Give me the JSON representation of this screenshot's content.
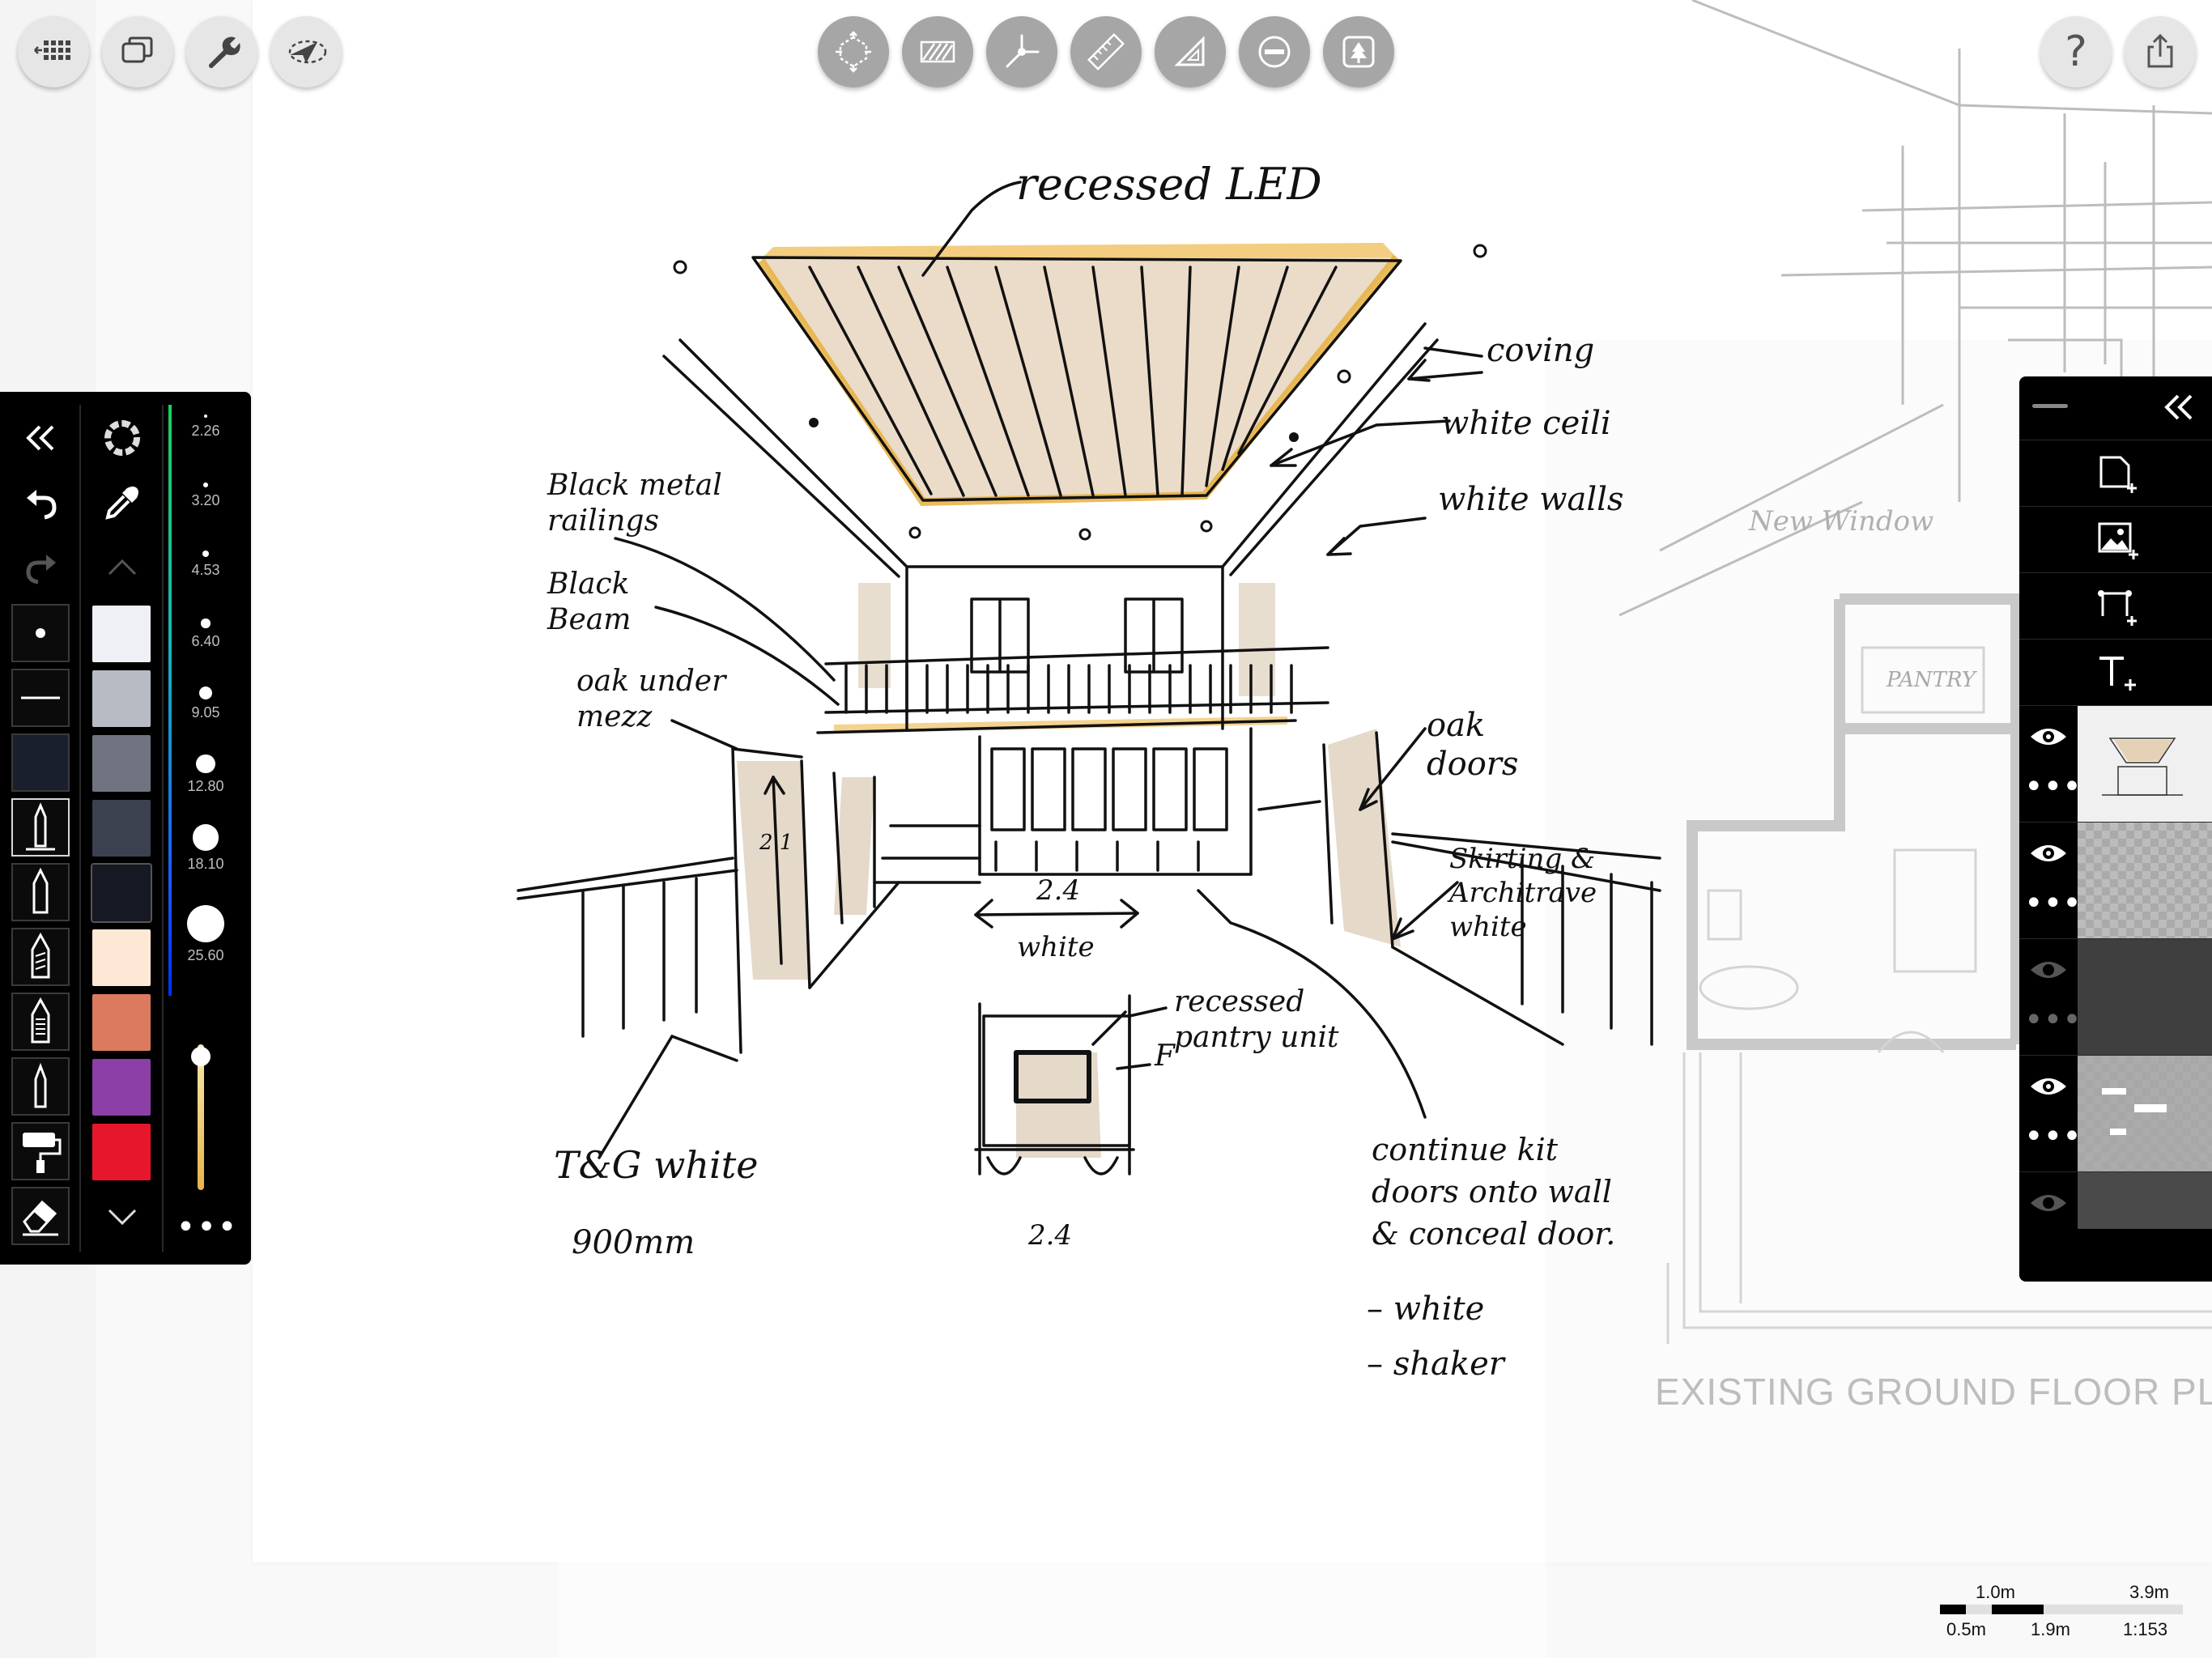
{
  "toolbar_left": {
    "gallery_icon": "grid-back-icon",
    "layers_toggle_icon": "duplicate-icon",
    "settings_icon": "wrench-icon",
    "select_icon": "lasso-arrow-icon"
  },
  "toolbar_center": {
    "tools": [
      {
        "name": "transform-icon"
      },
      {
        "name": "hatch-icon"
      },
      {
        "name": "perspective-icon"
      },
      {
        "name": "ruler-icon"
      },
      {
        "name": "set-square-icon"
      },
      {
        "name": "ellipse-guide-icon"
      },
      {
        "name": "stamp-icon"
      }
    ]
  },
  "toolbar_right": {
    "help_label": "?",
    "share_icon": "share-icon"
  },
  "palette": {
    "colors": [
      "#eef0f6",
      "#b7bbc3",
      "#6f7480",
      "#3c414f",
      "#161923",
      "#fde8d6",
      "#dc7a5f",
      "#8c3fa6",
      "#e6172c"
    ],
    "color_selected_index": 4,
    "sizes": [
      "2.26",
      "3.20",
      "4.53",
      "6.40",
      "9.05",
      "12.80",
      "18.10",
      "25.60"
    ],
    "opacity": 0.98,
    "more_label": "•••"
  },
  "layers": {
    "rows": [
      {
        "visible": true
      },
      {
        "visible": true
      },
      {
        "visible": false
      },
      {
        "visible": true
      },
      {
        "visible": false
      }
    ],
    "more_label": "•••"
  },
  "scale": {
    "top_left": "1.0m",
    "top_right": "3.9m",
    "bottom_left": "0.5m",
    "bottom_mid": "1.9m",
    "ratio": "1:153"
  },
  "sketch": {
    "plan_title": "EXISTING GROUND FLOOR PL",
    "notes": {
      "recessed_led": "recessed LED",
      "coving": "coving",
      "white_ceiling": "white ceili",
      "white_walls": "white walls",
      "railings": "Black metal railings",
      "beam": "Black Beam",
      "oak_mezz": "oak under mezz",
      "oak_doors": "oak doors",
      "skirting": "Skirting & Architrave white",
      "dim_24": "2.4",
      "white": "white",
      "dim_21": "2.1",
      "recessed_pantry": "recessed pantry unit",
      "f_mark": "F",
      "tg_white": "T&G white",
      "mm900": "900mm",
      "dim_24_b": "2.4",
      "continue": "continue kit doors onto wall & conceal door.",
      "dash_white": "– white",
      "dash_shaker": "– shaker",
      "new_window": "New Window",
      "pantry": "PANTRY"
    }
  }
}
